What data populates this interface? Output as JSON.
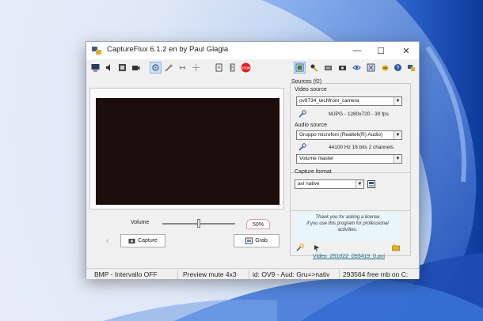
{
  "window": {
    "title": "CaptureFlux 6.1.2 en by Paul Glagla",
    "controls": {
      "minimize": "—",
      "maximize": "☐",
      "close": "✕"
    }
  },
  "toolbar_left": [
    "monitor-icon",
    "speaker-icon",
    "film-icon",
    "camera-icon",
    "grab-icon",
    "wand-icon",
    "arrows-icon",
    "move-icon"
  ],
  "toolbar_mid": [
    "notes-icon",
    "ruler-icon",
    "stop-icon"
  ],
  "toolbar_mid_stop_label": "STOP",
  "toolbar_right": [
    "preview-icon",
    "settings-icon",
    "folder-icon",
    "camera-small-icon",
    "eye-icon",
    "filter-icon",
    "bee-icon",
    "help-icon",
    "info-icon"
  ],
  "preview": {
    "volume_label": "Volume",
    "volume_value": 0.5,
    "volume_percent": "50%",
    "capture_button": "Capture",
    "grab_button": "Grab"
  },
  "sources": {
    "heading": "Sources (f2)",
    "video_label": "Video source",
    "video_value": "ov9734_techfront_camera",
    "video_info": "MJPG - 1280x720 - 30 fps",
    "audio_label": "Audio source",
    "audio_value": "Gruppo microfoni (Realtek(R) Audio)",
    "audio_info": "44100 Hz 16 bits 2 channels",
    "volume_master": "Volume master"
  },
  "format": {
    "label": "Capture format",
    "value": "avi native",
    "license_text": "Thank you for asking a license\nif you use this program for professional\nactivities.",
    "filename": "Video_251022_093419_0.avi"
  },
  "status": {
    "s1": "BMP - Intervallo OFF",
    "s2": "Preview mute 4x3",
    "s3": "id: OV9 - Aud: Gru=>nativ",
    "s4": "293564 free mb on C:"
  },
  "colors": {
    "preview_bg": "#1b0c0e",
    "link": "#1a6f8a",
    "stop": "#e02020"
  }
}
